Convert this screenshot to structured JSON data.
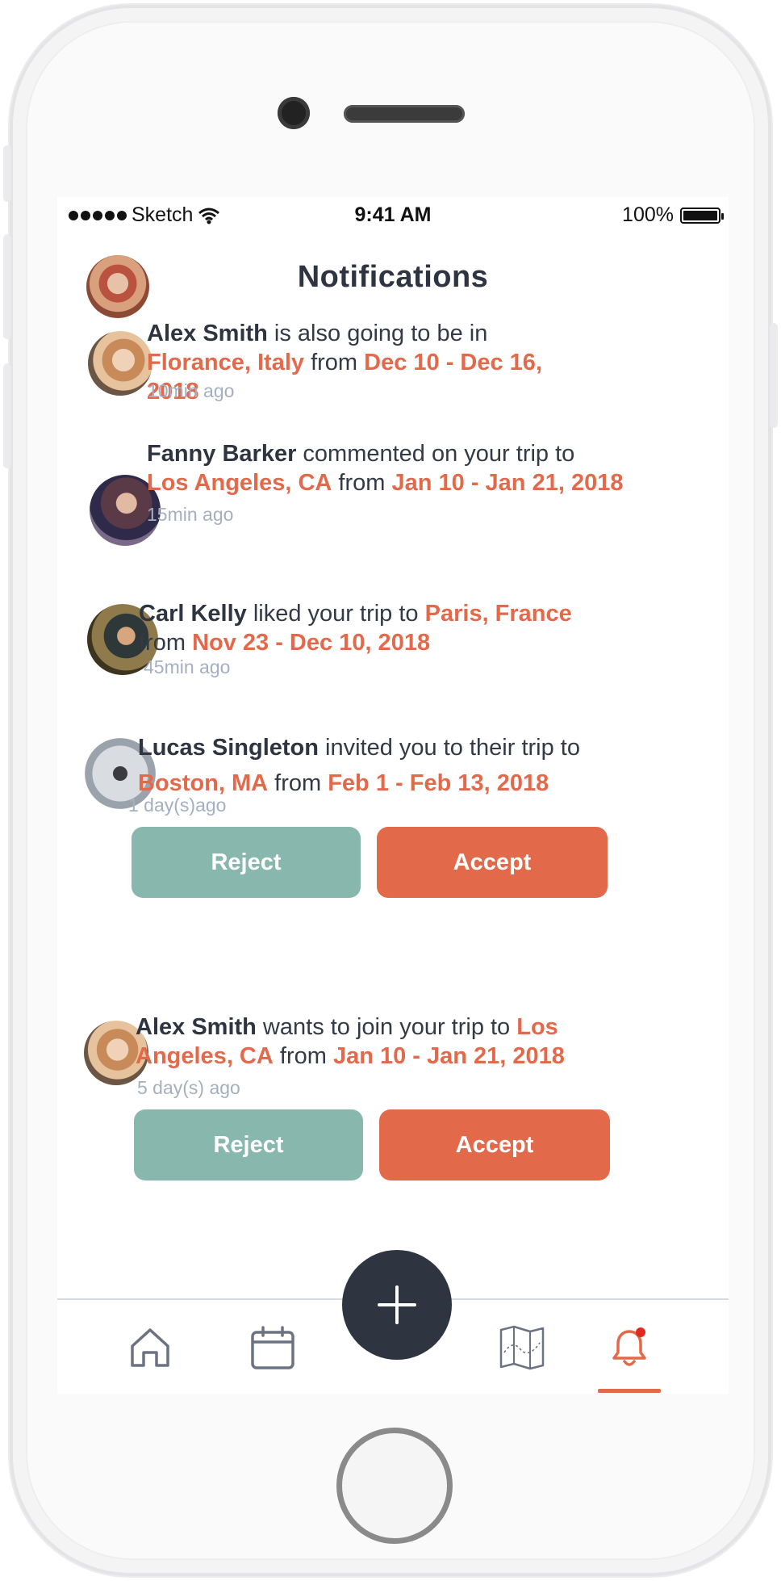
{
  "status_bar": {
    "carrier": "Sketch",
    "time": "9:41 AM",
    "battery": "100%"
  },
  "header": {
    "title": "Notifications"
  },
  "notifications": [
    {
      "name": "Alex Smith",
      "action": " is also going to be in ",
      "place": "Florance, Italy",
      "from": " from ",
      "dates": "Dec 10 - Dec 16, 2018",
      "time": "10min ago"
    },
    {
      "name": "Fanny Barker",
      "action": " commented on your trip to ",
      "place": "Los Angeles, CA",
      "from": " from ",
      "dates": "Jan 10 - Jan 21, 2018",
      "time": "15min ago"
    },
    {
      "name": "Carl Kelly",
      "action": " liked your trip to ",
      "place": "Paris, France",
      "from": "from ",
      "dates": "Nov 23 - Dec 10, 2018",
      "time": "45min ago"
    },
    {
      "name": "Lucas Singleton",
      "action": " invited you to their trip to ",
      "place": "Boston, MA",
      "from": " from ",
      "dates": "Feb 1 - Feb 13, 2018",
      "time": "1 day(s)ago",
      "reject_label": "Reject",
      "accept_label": "Accept"
    },
    {
      "name": "Alex Smith",
      "action": " wants to join your trip to ",
      "place": "Los Angeles, CA",
      "from": " from ",
      "dates": "Jan 10 - Jan 21, 2018",
      "time": "5 day(s) ago",
      "reject_label": "Reject",
      "accept_label": "Accept"
    }
  ],
  "tabbar": {
    "items": [
      {
        "icon": "home-icon"
      },
      {
        "icon": "calendar-icon"
      },
      {
        "icon": "plus-icon"
      },
      {
        "icon": "map-icon"
      },
      {
        "icon": "bell-icon",
        "active": true
      }
    ]
  },
  "colors": {
    "accent": "#e3694b",
    "reject": "#88b7ae",
    "dark": "#2e3440",
    "muted": "#a4afbf"
  }
}
